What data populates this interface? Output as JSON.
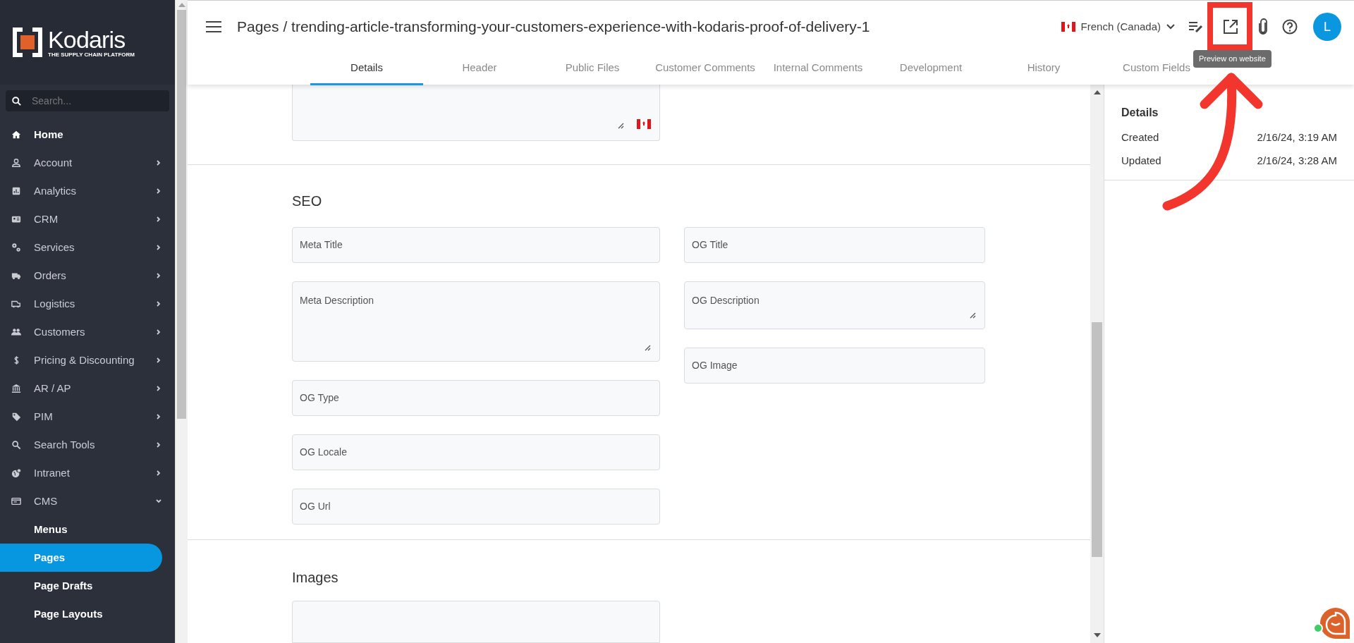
{
  "sidebar": {
    "logo": {
      "name": "Kodaris",
      "tagline": "THE SUPPLY CHAIN PLATFORM"
    },
    "search": {
      "placeholder": "Search..."
    },
    "items": [
      {
        "label": "Home"
      },
      {
        "label": "Account",
        "expanded": false
      },
      {
        "label": "Analytics",
        "expanded": false
      },
      {
        "label": "CRM",
        "expanded": false
      },
      {
        "label": "Services",
        "expanded": false
      },
      {
        "label": "Orders",
        "expanded": false
      },
      {
        "label": "Logistics",
        "expanded": false
      },
      {
        "label": "Customers",
        "expanded": false
      },
      {
        "label": "Pricing & Discounting",
        "expanded": false
      },
      {
        "label": "AR / AP",
        "expanded": false
      },
      {
        "label": "PIM",
        "expanded": false
      },
      {
        "label": "Search Tools",
        "expanded": false
      },
      {
        "label": "Intranet",
        "expanded": false
      },
      {
        "label": "CMS",
        "expanded": true,
        "children": [
          {
            "label": "Menus",
            "selected": false
          },
          {
            "label": "Pages",
            "selected": true
          },
          {
            "label": "Page Drafts",
            "selected": false
          },
          {
            "label": "Page Layouts",
            "selected": false
          }
        ]
      }
    ]
  },
  "header": {
    "title": "Pages / trending-article-transforming-your-customers-experience-with-kodaris-proof-of-delivery-1",
    "language": "French (Canada)",
    "avatar": "L",
    "tooltip": "Preview on website"
  },
  "tabs": [
    {
      "label": "Details",
      "selected": true
    },
    {
      "label": "Header",
      "selected": false
    },
    {
      "label": "Public Files",
      "selected": false
    },
    {
      "label": "Customer Comments",
      "selected": false
    },
    {
      "label": "Internal Comments",
      "selected": false
    },
    {
      "label": "Development",
      "selected": false
    },
    {
      "label": "History",
      "selected": false
    },
    {
      "label": "Custom Fields",
      "selected": false
    }
  ],
  "seo": {
    "title": "SEO",
    "left_fields": [
      {
        "label": "Meta Title",
        "kind": "input"
      },
      {
        "label": "Meta Description",
        "kind": "textarea"
      },
      {
        "label": "OG Type",
        "kind": "input"
      },
      {
        "label": "OG Locale",
        "kind": "input"
      },
      {
        "label": "OG Url",
        "kind": "input"
      }
    ],
    "right_fields": [
      {
        "label": "OG Title",
        "kind": "input"
      },
      {
        "label": "OG Description",
        "kind": "short_textarea"
      },
      {
        "label": "OG Image",
        "kind": "input"
      }
    ]
  },
  "images": {
    "title": "Images"
  },
  "details": {
    "title": "Details",
    "rows": [
      {
        "label": "Created",
        "value": "2/16/24, 3:19 AM"
      },
      {
        "label": "Updated",
        "value": "2/16/24, 3:28 AM"
      }
    ]
  }
}
